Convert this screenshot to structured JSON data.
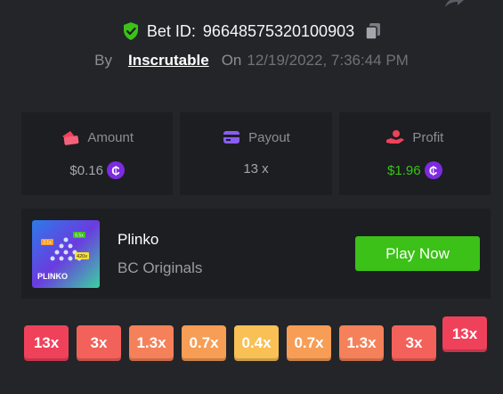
{
  "bet": {
    "label": "Bet ID:",
    "id": "96648575320100903"
  },
  "byline": {
    "by": "By",
    "user": "Inscrutable",
    "on": "On",
    "timestamp": "12/19/2022, 7:36:44 PM"
  },
  "cards": [
    {
      "title": "Amount",
      "value": "$0.16",
      "icon": "wallet-icon",
      "coin": "₵"
    },
    {
      "title": "Payout",
      "value": "13 x",
      "icon": "card-icon"
    },
    {
      "title": "Profit",
      "value": "$1.96",
      "icon": "hand-coin-icon",
      "coin": "₵"
    }
  ],
  "game": {
    "name": "Plinko",
    "provider": "BC Originals",
    "play_label": "Play Now",
    "thumb_text": "PLINKO",
    "thumb_badges": [
      "2.1x",
      "6.5x",
      "420x"
    ]
  },
  "multipliers": [
    {
      "label": "13x",
      "color": "#f0415b",
      "highlight": false
    },
    {
      "label": "3x",
      "color": "#f2625a",
      "highlight": false
    },
    {
      "label": "1.3x",
      "color": "#f4815a",
      "highlight": false
    },
    {
      "label": "0.7x",
      "color": "#f79d55",
      "highlight": false
    },
    {
      "label": "0.4x",
      "color": "#f8c055",
      "highlight": false
    },
    {
      "label": "0.7x",
      "color": "#f79d55",
      "highlight": false
    },
    {
      "label": "1.3x",
      "color": "#f4815a",
      "highlight": false
    },
    {
      "label": "3x",
      "color": "#f2625a",
      "highlight": false
    },
    {
      "label": "13x",
      "color": "#f0415b",
      "highlight": true
    }
  ],
  "colors": {
    "accent_green": "#3bc117",
    "coin_purple": "#7d2be0",
    "panel": "#1c1e22",
    "background": "#232529"
  }
}
